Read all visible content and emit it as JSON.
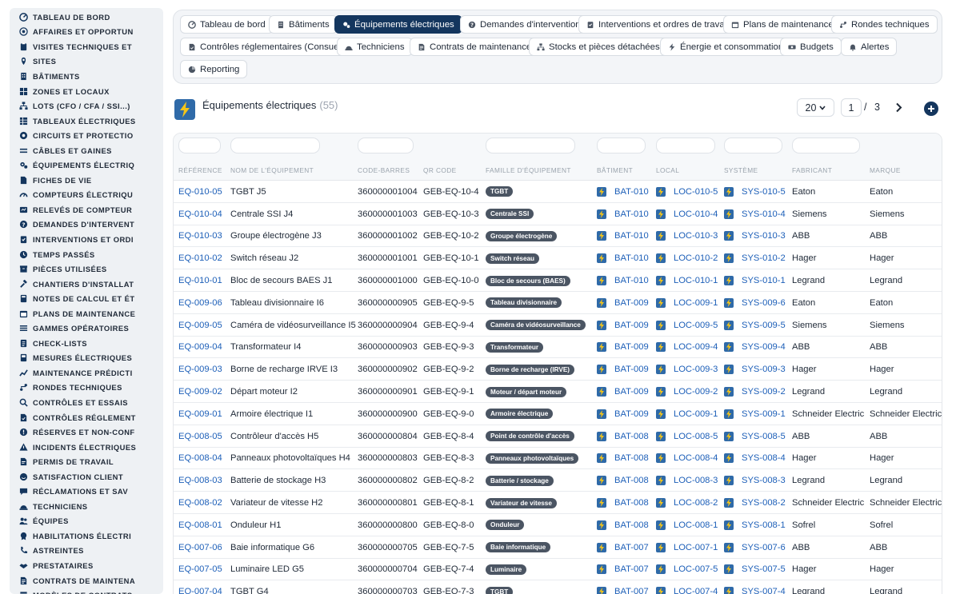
{
  "sidebar": {
    "items": [
      {
        "icon": "dashboard-icon",
        "label": "TABLEAU DE BORD"
      },
      {
        "icon": "target-icon",
        "label": "AFFAIRES ET OPPORTUN"
      },
      {
        "icon": "clipboard-icon",
        "label": "VISITES TECHNIQUES ET"
      },
      {
        "icon": "map-pin-icon",
        "label": "SITES"
      },
      {
        "icon": "building-icon",
        "label": "BÂTIMENTS"
      },
      {
        "icon": "grid-icon",
        "label": "ZONES ET LOCAUX"
      },
      {
        "icon": "sitemap-icon",
        "label": "LOTS (CFO / CFA / SSI...)"
      },
      {
        "icon": "table-icon",
        "label": "TABLEAUX ÉLECTRIQUES"
      },
      {
        "icon": "circuit-icon",
        "label": "CIRCUITS ET PROTECTIO"
      },
      {
        "icon": "cable-icon",
        "label": "CÂBLES ET GAINES"
      },
      {
        "icon": "cogs-icon",
        "label": "ÉQUIPEMENTS ÉLECTRIQ"
      },
      {
        "icon": "file-icon",
        "label": "FICHES DE VIE"
      },
      {
        "icon": "gauge-icon",
        "label": "COMPTEURS ÉLECTRIQU"
      },
      {
        "icon": "reading-icon",
        "label": "RELEVÉS DE COMPTEUR"
      },
      {
        "icon": "question-icon",
        "label": "DEMANDES D'INTERVENT"
      },
      {
        "icon": "clipboard-check-icon",
        "label": "INTERVENTIONS ET ORDI"
      },
      {
        "icon": "clock-icon",
        "label": "TEMPS PASSÉS"
      },
      {
        "icon": "box-icon",
        "label": "PIÈCES UTILISÉES"
      },
      {
        "icon": "hammer-icon",
        "label": "CHANTIERS D'INSTALLAT"
      },
      {
        "icon": "calculator-icon",
        "label": "NOTES DE CALCUL ET ÉT"
      },
      {
        "icon": "calendar-icon",
        "label": "PLANS DE MAINTENANCE"
      },
      {
        "icon": "list-icon",
        "label": "GAMMES OPÉRATOIRES"
      },
      {
        "icon": "checklist-icon",
        "label": "CHECK-LISTS"
      },
      {
        "icon": "measure-icon",
        "label": "MESURES ÉLECTRIQUES"
      },
      {
        "icon": "chart-icon",
        "label": "MAINTENANCE PRÉDICTI"
      },
      {
        "icon": "route-icon",
        "label": "RONDES TECHNIQUES"
      },
      {
        "icon": "search-icon",
        "label": "CONTRÔLES ET ESSAIS"
      },
      {
        "icon": "file-check-icon",
        "label": "CONTRÔLES RÉGLEMENT"
      },
      {
        "icon": "warning-icon",
        "label": "RÉSERVES ET NON-CONF"
      },
      {
        "icon": "bolt-alert-icon",
        "label": "INCIDENTS ÉLECTRIQUES"
      },
      {
        "icon": "permit-icon",
        "label": "PERMIS DE TRAVAIL"
      },
      {
        "icon": "smile-icon",
        "label": "SATISFACTION CLIENT"
      },
      {
        "icon": "comment-icon",
        "label": "RÉCLAMATIONS ET SAV"
      },
      {
        "icon": "hardhat-icon",
        "label": "TECHNICIENS"
      },
      {
        "icon": "users-icon",
        "label": "ÉQUIPES"
      },
      {
        "icon": "badge-icon",
        "label": "HABILITATIONS ÉLECTRI"
      },
      {
        "icon": "phone-icon",
        "label": "ASTREINTES"
      },
      {
        "icon": "handshake-icon",
        "label": "PRESTATAIRES"
      },
      {
        "icon": "contract-icon",
        "label": "CONTRATS DE MAINTENA"
      },
      {
        "icon": "template-icon",
        "label": "MODÈLES DE CONTRATS"
      }
    ]
  },
  "tabs": [
    {
      "icon": "dashboard-icon",
      "label": "Tableau de bord",
      "active": false
    },
    {
      "icon": "building-icon",
      "label": "Bâtiments",
      "active": false
    },
    {
      "icon": "cogs-icon",
      "label": "Équipements électriques",
      "active": true
    },
    {
      "icon": "question-icon",
      "label": "Demandes d'intervention",
      "active": false
    },
    {
      "icon": "clipboard-check-icon",
      "label": "Interventions et ordres de travail",
      "active": false
    },
    {
      "icon": "calendar-icon",
      "label": "Plans de maintenance",
      "active": false
    },
    {
      "icon": "route-icon",
      "label": "Rondes techniques",
      "active": false
    },
    {
      "icon": "file-check-icon",
      "label": "Contrôles réglementaires (Consuel)",
      "active": false
    },
    {
      "icon": "hardhat-icon",
      "label": "Techniciens",
      "active": false
    },
    {
      "icon": "contract-icon",
      "label": "Contrats de maintenance",
      "active": false
    },
    {
      "icon": "sitemap-icon",
      "label": "Stocks et pièces détachées",
      "active": false
    },
    {
      "icon": "bolt-icon",
      "label": "Énergie et consommation",
      "active": false
    },
    {
      "icon": "money-icon",
      "label": "Budgets",
      "active": false
    },
    {
      "icon": "bell-icon",
      "label": "Alertes",
      "active": false
    },
    {
      "icon": "pie-icon",
      "label": "Reporting",
      "active": false
    }
  ],
  "header": {
    "title": "Équipements électriques",
    "count": "(55)"
  },
  "pagination": {
    "page_size": "20",
    "current_page": "1",
    "separator": "/",
    "total_pages": "3"
  },
  "table": {
    "columns": [
      "RÉFÉRENCE",
      "NOM DE L'ÉQUIPEMENT",
      "CODE-BARRES",
      "QR CODE",
      "FAMILLE D'ÉQUIPEMENT",
      "BÂTIMENT",
      "LOCAL",
      "SYSTÈME",
      "FABRICANT",
      "MARQUE"
    ],
    "rows": [
      {
        "ref": "EQ-010-05",
        "name": "TGBT J5",
        "barcode": "360000001004",
        "qr": "GEB-EQ-10-4",
        "family": "TGBT",
        "building": "BAT-010",
        "local": "LOC-010-5",
        "system": "SYS-010-5",
        "maker": "Eaton",
        "brand": "Eaton"
      },
      {
        "ref": "EQ-010-04",
        "name": "Centrale SSI J4",
        "barcode": "360000001003",
        "qr": "GEB-EQ-10-3",
        "family": "Centrale SSI",
        "building": "BAT-010",
        "local": "LOC-010-4",
        "system": "SYS-010-4",
        "maker": "Siemens",
        "brand": "Siemens"
      },
      {
        "ref": "EQ-010-03",
        "name": "Groupe électrogène J3",
        "barcode": "360000001002",
        "qr": "GEB-EQ-10-2",
        "family": "Groupe électrogène",
        "building": "BAT-010",
        "local": "LOC-010-3",
        "system": "SYS-010-3",
        "maker": "ABB",
        "brand": "ABB"
      },
      {
        "ref": "EQ-010-02",
        "name": "Switch réseau J2",
        "barcode": "360000001001",
        "qr": "GEB-EQ-10-1",
        "family": "Switch réseau",
        "building": "BAT-010",
        "local": "LOC-010-2",
        "system": "SYS-010-2",
        "maker": "Hager",
        "brand": "Hager"
      },
      {
        "ref": "EQ-010-01",
        "name": "Bloc de secours BAES J1",
        "barcode": "360000001000",
        "qr": "GEB-EQ-10-0",
        "family": "Bloc de secours (BAES)",
        "building": "BAT-010",
        "local": "LOC-010-1",
        "system": "SYS-010-1",
        "maker": "Legrand",
        "brand": "Legrand"
      },
      {
        "ref": "EQ-009-06",
        "name": "Tableau divisionnaire I6",
        "barcode": "360000000905",
        "qr": "GEB-EQ-9-5",
        "family": "Tableau divisionnaire",
        "building": "BAT-009",
        "local": "LOC-009-1",
        "system": "SYS-009-6",
        "maker": "Eaton",
        "brand": "Eaton"
      },
      {
        "ref": "EQ-009-05",
        "name": "Caméra de vidéosurveillance I5",
        "barcode": "360000000904",
        "qr": "GEB-EQ-9-4",
        "family": "Caméra de vidéosurveillance",
        "building": "BAT-009",
        "local": "LOC-009-5",
        "system": "SYS-009-5",
        "maker": "Siemens",
        "brand": "Siemens"
      },
      {
        "ref": "EQ-009-04",
        "name": "Transformateur I4",
        "barcode": "360000000903",
        "qr": "GEB-EQ-9-3",
        "family": "Transformateur",
        "building": "BAT-009",
        "local": "LOC-009-4",
        "system": "SYS-009-4",
        "maker": "ABB",
        "brand": "ABB"
      },
      {
        "ref": "EQ-009-03",
        "name": "Borne de recharge IRVE I3",
        "barcode": "360000000902",
        "qr": "GEB-EQ-9-2",
        "family": "Borne de recharge (IRVE)",
        "building": "BAT-009",
        "local": "LOC-009-3",
        "system": "SYS-009-3",
        "maker": "Hager",
        "brand": "Hager"
      },
      {
        "ref": "EQ-009-02",
        "name": "Départ moteur I2",
        "barcode": "360000000901",
        "qr": "GEB-EQ-9-1",
        "family": "Moteur / départ moteur",
        "building": "BAT-009",
        "local": "LOC-009-2",
        "system": "SYS-009-2",
        "maker": "Legrand",
        "brand": "Legrand"
      },
      {
        "ref": "EQ-009-01",
        "name": "Armoire électrique I1",
        "barcode": "360000000900",
        "qr": "GEB-EQ-9-0",
        "family": "Armoire électrique",
        "building": "BAT-009",
        "local": "LOC-009-1",
        "system": "SYS-009-1",
        "maker": "Schneider Electric",
        "brand": "Schneider Electric"
      },
      {
        "ref": "EQ-008-05",
        "name": "Contrôleur d'accès H5",
        "barcode": "360000000804",
        "qr": "GEB-EQ-8-4",
        "family": "Point de contrôle d'accès",
        "building": "BAT-008",
        "local": "LOC-008-5",
        "system": "SYS-008-5",
        "maker": "ABB",
        "brand": "ABB"
      },
      {
        "ref": "EQ-008-04",
        "name": "Panneaux photovoltaïques H4",
        "barcode": "360000000803",
        "qr": "GEB-EQ-8-3",
        "family": "Panneaux photovoltaïques",
        "building": "BAT-008",
        "local": "LOC-008-4",
        "system": "SYS-008-4",
        "maker": "Hager",
        "brand": "Hager"
      },
      {
        "ref": "EQ-008-03",
        "name": "Batterie de stockage H3",
        "barcode": "360000000802",
        "qr": "GEB-EQ-8-2",
        "family": "Batterie / stockage",
        "building": "BAT-008",
        "local": "LOC-008-3",
        "system": "SYS-008-3",
        "maker": "Legrand",
        "brand": "Legrand"
      },
      {
        "ref": "EQ-008-02",
        "name": "Variateur de vitesse H2",
        "barcode": "360000000801",
        "qr": "GEB-EQ-8-1",
        "family": "Variateur de vitesse",
        "building": "BAT-008",
        "local": "LOC-008-2",
        "system": "SYS-008-2",
        "maker": "Schneider Electric",
        "brand": "Schneider Electric"
      },
      {
        "ref": "EQ-008-01",
        "name": "Onduleur H1",
        "barcode": "360000000800",
        "qr": "GEB-EQ-8-0",
        "family": "Onduleur",
        "building": "BAT-008",
        "local": "LOC-008-1",
        "system": "SYS-008-1",
        "maker": "Sofrel",
        "brand": "Sofrel"
      },
      {
        "ref": "EQ-007-06",
        "name": "Baie informatique G6",
        "barcode": "360000000705",
        "qr": "GEB-EQ-7-5",
        "family": "Baie informatique",
        "building": "BAT-007",
        "local": "LOC-007-1",
        "system": "SYS-007-6",
        "maker": "ABB",
        "brand": "ABB"
      },
      {
        "ref": "EQ-007-05",
        "name": "Luminaire LED G5",
        "barcode": "360000000704",
        "qr": "GEB-EQ-7-4",
        "family": "Luminaire",
        "building": "BAT-007",
        "local": "LOC-007-5",
        "system": "SYS-007-5",
        "maker": "Hager",
        "brand": "Hager"
      },
      {
        "ref": "EQ-007-04",
        "name": "TGBT G4",
        "barcode": "360000000703",
        "qr": "GEB-EQ-7-3",
        "family": "TGBT",
        "building": "BAT-007",
        "local": "LOC-007-4",
        "system": "SYS-007-4",
        "maker": "Legrand",
        "brand": "Legrand"
      }
    ]
  },
  "colors": {
    "accent": "#14365e",
    "link": "#1d5fb8",
    "pill": "#4b5563",
    "icon_bg": "#2f6aa8",
    "bolt": "#f5c518"
  }
}
